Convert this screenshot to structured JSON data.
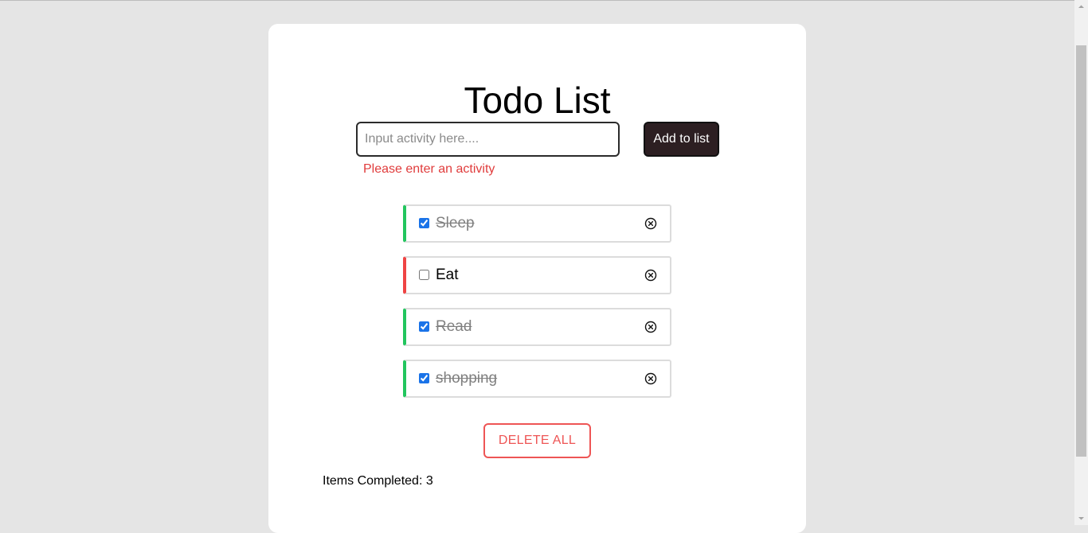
{
  "app": {
    "title": "Todo List"
  },
  "form": {
    "input_value": "",
    "input_placeholder": "Input activity here....",
    "add_button_label": "Add to list",
    "error_message": "Please enter an activity"
  },
  "todos": [
    {
      "text": "Sleep",
      "completed": true
    },
    {
      "text": "Eat",
      "completed": false
    },
    {
      "text": "Read",
      "completed": true
    },
    {
      "text": "shopping",
      "completed": true
    }
  ],
  "actions": {
    "delete_all_label": "DELETE ALL"
  },
  "summary": {
    "completed_label": "Items Completed: 3"
  },
  "icons": {
    "remove": "close-circle-icon"
  },
  "colors": {
    "background": "#e5e5e5",
    "card": "#ffffff",
    "accent_dark": "#2d1f22",
    "danger": "#ee5555",
    "error_text": "#e03c3c",
    "completed_border": "#22c55e",
    "pending_border": "#ef4444",
    "completed_text": "#808080"
  }
}
